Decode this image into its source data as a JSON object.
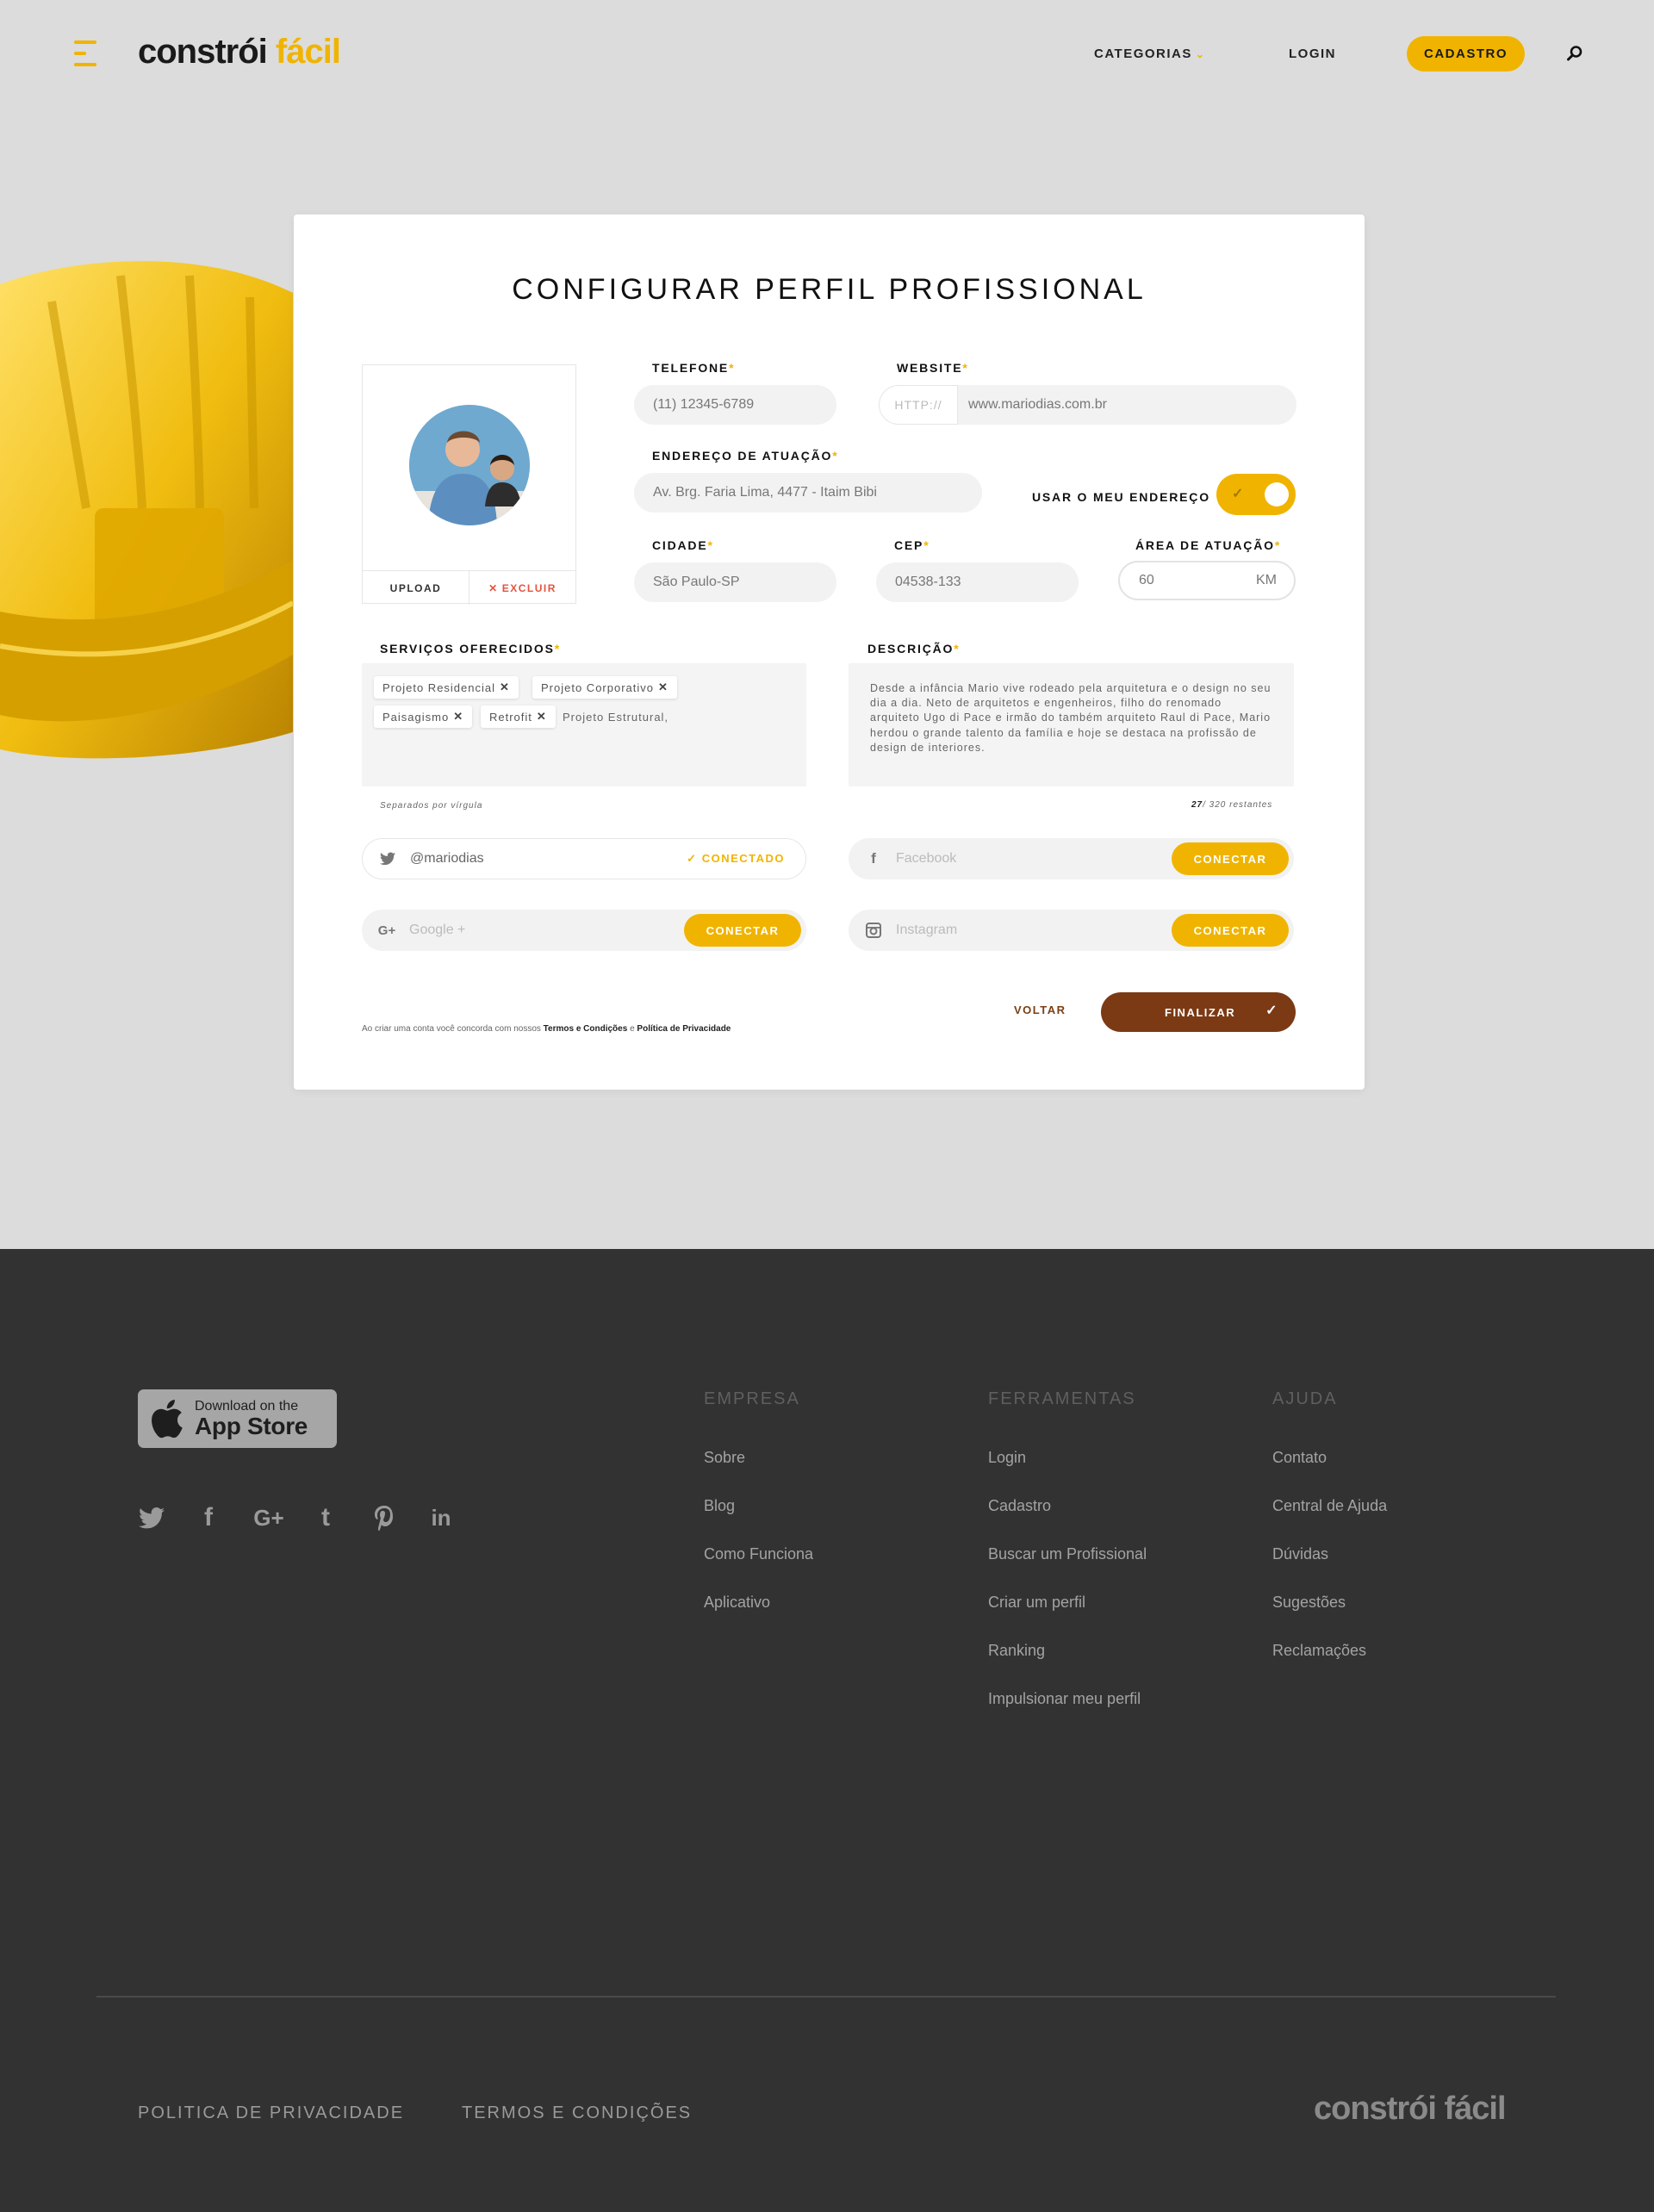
{
  "header": {
    "logo_part1": "constrói",
    "logo_part2": "fácil",
    "nav_categorias": "CATEGORIAS",
    "nav_login": "LOGIN",
    "nav_cadastro": "CADASTRO"
  },
  "form": {
    "title": "CONFIGURAR PERFIL PROFISSIONAL",
    "avatar_upload": "UPLOAD",
    "avatar_delete": "EXCLUIR",
    "telefone_label": "TELEFONE",
    "telefone_value": "(11) 12345-6789",
    "website_label": "WEBSITE",
    "website_prefix": "HTTP://",
    "website_value": "www.mariodias.com.br",
    "endereco_label": "ENDEREÇO DE ATUAÇÃO",
    "endereco_value": "Av. Brg. Faria Lima, 4477 - Itaim Bibi",
    "usar_endereco_label": "USAR O MEU ENDEREÇO",
    "usar_endereco_on": true,
    "cidade_label": "CIDADE",
    "cidade_value": "São Paulo-SP",
    "cep_label": "CEP",
    "cep_value": "04538-133",
    "area_label": "ÁREA DE ATUAÇÃO",
    "area_value": "60",
    "area_unit": "KM",
    "required_mark": "*",
    "servicos_label": "SERVIÇOS OFERECIDOS",
    "servicos_tags": [
      "Projeto Residencial",
      "Projeto Corporativo",
      "Paisagismo",
      "Retrofit"
    ],
    "servicos_typing": "Projeto Estrutural,",
    "servicos_hint": "Separados por vírgula",
    "descricao_label": "DESCRIÇÃO",
    "descricao_value": "Desde a infância Mario vive rodeado pela arquitetura e o design no seu dia a dia. Neto de arquitetos e engenheiros, filho do renomado arquiteto Ugo di Pace e irmão do também arquiteto Raul di Pace, Mario herdou o grande talento da família e hoje se destaca na profissão de design de interiores.",
    "descricao_count": "27",
    "descricao_count_suffix": "/ 320 restantes",
    "twitter_value": "@mariodias",
    "twitter_status": "CONECTADO",
    "facebook_placeholder": "Facebook",
    "google_placeholder": "Google +",
    "instagram_placeholder": "Instagram",
    "connect_label": "CONECTAR",
    "terms_prefix": "Ao criar uma conta você concorda com nossos",
    "terms_link": "Termos e Condições",
    "terms_and": "e",
    "privacy_link": "Política de Privacidade",
    "voltar_label": "VOLTAR",
    "finalizar_label": "FINALIZAR"
  },
  "footer": {
    "appstore_small": "Download on the",
    "appstore_big": "App Store",
    "columns": [
      {
        "title": "EMPRESA",
        "items": [
          "Sobre",
          "Blog",
          "Como Funciona",
          "Aplicativo"
        ]
      },
      {
        "title": "FERRAMENTAS",
        "items": [
          "Login",
          "Cadastro",
          "Buscar um Profissional",
          "Criar um perfil",
          "Ranking",
          "Impulsionar meu perfil"
        ]
      },
      {
        "title": "AJUDA",
        "items": [
          "Contato",
          "Central de Ajuda",
          "Dúvidas",
          "Sugestões",
          "Reclamações"
        ]
      }
    ],
    "privacy": "POLITICA DE PRIVACIDADE",
    "terms": "TERMOS E CONDIÇÕES",
    "logo": "constrói fácil"
  },
  "colors": {
    "accent": "#f0b400",
    "brown": "#7b3a14",
    "footer_bg": "#323232",
    "page_bg": "#dcdcdc",
    "delete": "#e55340"
  },
  "icons": [
    "menu-icon",
    "chevron-down-icon",
    "search-icon",
    "close-icon",
    "check-icon",
    "twitter-icon",
    "facebook-icon",
    "google-plus-icon",
    "instagram-icon",
    "apple-icon",
    "tumblr-icon",
    "pinterest-icon",
    "linkedin-icon"
  ]
}
